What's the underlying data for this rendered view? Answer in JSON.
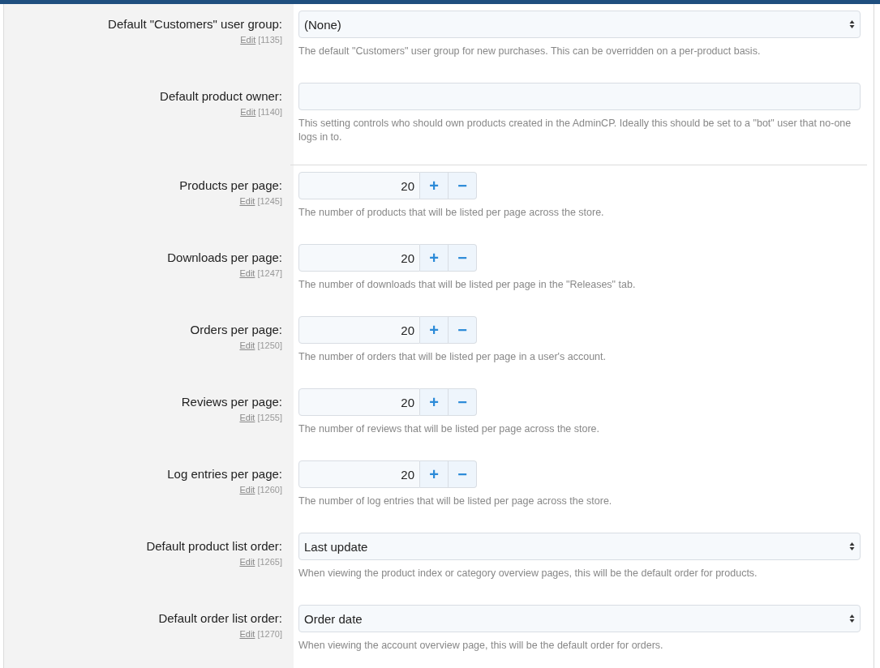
{
  "groups": [
    {
      "rows": [
        {
          "kind": "select",
          "label": "Default \"Customers\" user group:",
          "edit": "Edit",
          "id": "[1135]",
          "value": "(None)",
          "hint": "The default \"Customers\" user group for new purchases. This can be overridden on a per-product basis."
        },
        {
          "kind": "text",
          "label": "Default product owner:",
          "edit": "Edit",
          "id": "[1140]",
          "value": "",
          "hint": "This setting controls who should own products created in the AdminCP. Ideally this should be set to a \"bot\" user that no-one logs in to."
        }
      ]
    },
    {
      "rows": [
        {
          "kind": "spinner",
          "label": "Products per page:",
          "edit": "Edit",
          "id": "[1245]",
          "value": "20",
          "plus": "+",
          "minus": "−",
          "hint": "The number of products that will be listed per page across the store."
        },
        {
          "kind": "spinner",
          "label": "Downloads per page:",
          "edit": "Edit",
          "id": "[1247]",
          "value": "20",
          "plus": "+",
          "minus": "−",
          "hint": "The number of downloads that will be listed per page in the \"Releases\" tab."
        },
        {
          "kind": "spinner",
          "label": "Orders per page:",
          "edit": "Edit",
          "id": "[1250]",
          "value": "20",
          "plus": "+",
          "minus": "−",
          "hint": "The number of orders that will be listed per page in a user's account."
        },
        {
          "kind": "spinner",
          "label": "Reviews per page:",
          "edit": "Edit",
          "id": "[1255]",
          "value": "20",
          "plus": "+",
          "minus": "−",
          "hint": "The number of reviews that will be listed per page across the store."
        },
        {
          "kind": "spinner",
          "label": "Log entries per page:",
          "edit": "Edit",
          "id": "[1260]",
          "value": "20",
          "plus": "+",
          "minus": "−",
          "hint": "The number of log entries that will be listed per page across the store."
        },
        {
          "kind": "select",
          "label": "Default product list order:",
          "edit": "Edit",
          "id": "[1265]",
          "value": "Last update",
          "hint": "When viewing the product index or category overview pages, this will be the default order for products."
        },
        {
          "kind": "select",
          "label": "Default order list order:",
          "edit": "Edit",
          "id": "[1270]",
          "value": "Order date",
          "hint": "When viewing the account overview page, this will be the default order for orders."
        }
      ]
    }
  ]
}
